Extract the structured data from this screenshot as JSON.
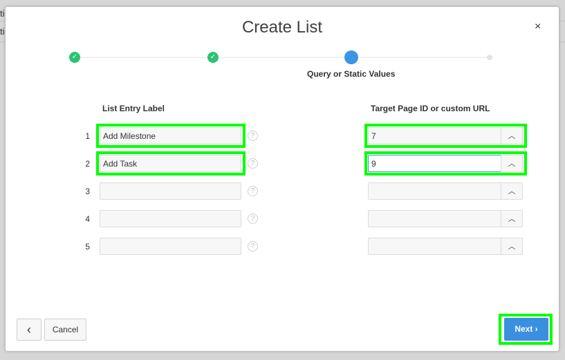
{
  "background": {
    "row_labels": [
      "ti",
      "ti"
    ]
  },
  "dialog": {
    "title": "Create List",
    "close_label": "×"
  },
  "wizard": {
    "steps": [
      {
        "state": "done",
        "icon": "check-icon"
      },
      {
        "state": "done",
        "icon": "check-icon"
      },
      {
        "state": "current",
        "label": "Query or Static Values"
      },
      {
        "state": "pending"
      }
    ],
    "check": "✓"
  },
  "columns": {
    "label_header": "List Entry Label",
    "target_header": "Target Page ID or custom URL"
  },
  "rows": [
    {
      "num": "1",
      "label": "Add Milestone",
      "target": "7"
    },
    {
      "num": "2",
      "label": "Add Task",
      "target": "9"
    },
    {
      "num": "3",
      "label": "",
      "target": ""
    },
    {
      "num": "4",
      "label": "",
      "target": ""
    },
    {
      "num": "5",
      "label": "",
      "target": ""
    }
  ],
  "help_glyph": "?",
  "up_glyph": "︿",
  "footer": {
    "back_glyph": "‹",
    "cancel": "Cancel",
    "next": "Next ›"
  },
  "colors": {
    "accent": "#3b8fe0",
    "done": "#2bc371",
    "highlight": "#00ff00"
  }
}
